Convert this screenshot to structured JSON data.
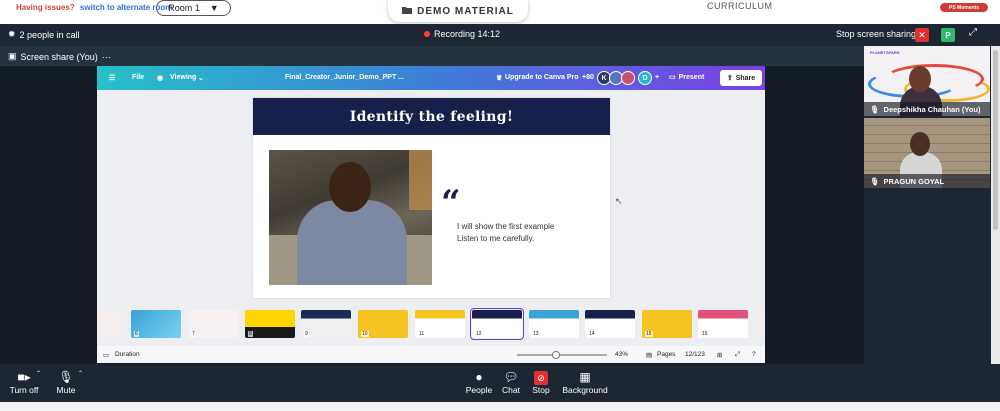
{
  "topbar": {
    "issues_text": "Having issues?",
    "issues_link": "switch to alternate room",
    "room_label": "Room 1",
    "demo_label": "DEMO MATERIAL",
    "curriculum": "CURRICULUM",
    "badge": "PS Moments"
  },
  "meeting": {
    "people_count": "2 people in call",
    "recording": "Recording 14:12",
    "stop_sharing": "Stop screen sharing",
    "participant_initial": "P"
  },
  "share": {
    "label": "Screen share (You)"
  },
  "canva": {
    "file": "File",
    "viewing": "Viewing",
    "doc_title": "Final_Creator_Junior_Demo_PPT ...",
    "upgrade": "Upgrade to Canva Pro",
    "collab_count": "+80",
    "avatars": [
      "K",
      "D"
    ],
    "present": "Present",
    "share": "Share",
    "duration": "Duration",
    "zoom": "43%",
    "zoom_fraction": 0.43,
    "pages": "Pages",
    "page_count": "12/123",
    "thumb_numbers": [
      "6",
      "7",
      "8",
      "9",
      "10",
      "11",
      "12",
      "13",
      "14",
      "15",
      "16"
    ]
  },
  "slide": {
    "title": "Identify the feeling!",
    "quote_mark": "“",
    "line1": "I will show the first example",
    "line2": "Listen to me carefully."
  },
  "participants": [
    {
      "name": "Deepshikha Chauhan (You)",
      "logo": "PLANETSPARK"
    },
    {
      "name": "PRAGUN GOYAL"
    }
  ],
  "controls": {
    "turn_off": "Turn off",
    "mute": "Mute",
    "people": "People",
    "chat": "Chat",
    "stop": "Stop",
    "background": "Background"
  },
  "colors": {
    "meeting_bg": "#1d2733",
    "slide_header": "#16204a",
    "record_dot": "#ff3b3b",
    "stop_red": "#e0302f",
    "participant_green": "#2fb86a"
  }
}
